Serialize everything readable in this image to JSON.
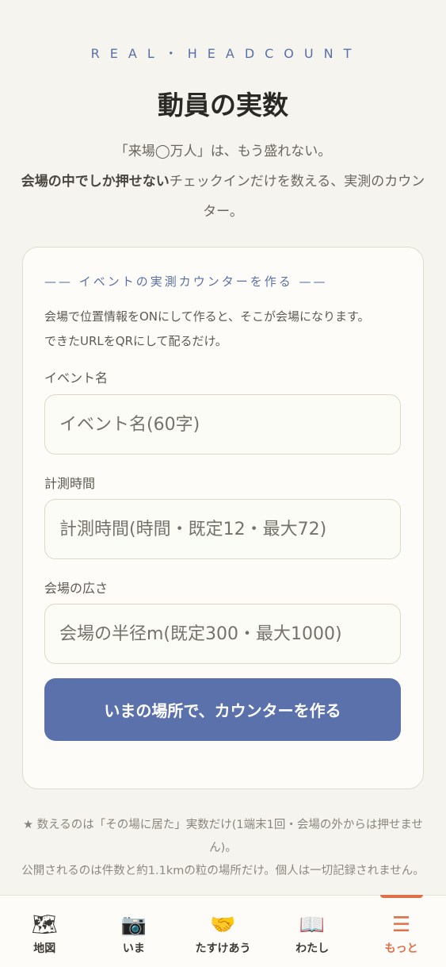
{
  "header": {
    "eyebrow": "REAL・HEADCOUNT",
    "title": "動員の実数",
    "lead_line1": "「来場◯万人」は、もう盛れない。",
    "lead_strong": "会場の中でしか押せない",
    "lead_rest": "チェックインだけを数える、実測のカウンター。"
  },
  "card": {
    "heading": "—— イベントの実測カウンターを作る ——",
    "desc_line1": "会場で位置情報をONにして作ると、そこが会場になります。",
    "desc_line2": "できたURLをQRにして配るだけ。",
    "fields": [
      {
        "label": "イベント名",
        "placeholder": "イベント名(60字)"
      },
      {
        "label": "計測時間",
        "placeholder": "計測時間(時間・既定12・最大72)"
      },
      {
        "label": "会場の広さ",
        "placeholder": "会場の半径m(既定300・最大1000)"
      }
    ],
    "submit_label": "いまの場所で、カウンターを作る"
  },
  "notes": {
    "line1": "★ 数えるのは「その場に居た」実数だけ(1端末1回・会場の外からは押せません)。",
    "line2": "公開されるのは件数と約1.1kmの粒の場所だけ。個人は一切記録されません。"
  },
  "tabbar": {
    "tabs": [
      {
        "label": "地図",
        "icon": "world-map-icon",
        "glyph": "🗺"
      },
      {
        "label": "いま",
        "icon": "camera-icon",
        "glyph": "📷"
      },
      {
        "label": "たすけあう",
        "icon": "handshake-icon",
        "glyph": "🤝"
      },
      {
        "label": "わたし",
        "icon": "open-book-icon",
        "glyph": "📖"
      },
      {
        "label": "もっと",
        "icon": "menu-icon",
        "glyph": "☰"
      }
    ],
    "active_index": 4,
    "accent_color": "#e0704a"
  },
  "colors": {
    "primary": "#5b71ab",
    "background": "#f6f4ef"
  }
}
